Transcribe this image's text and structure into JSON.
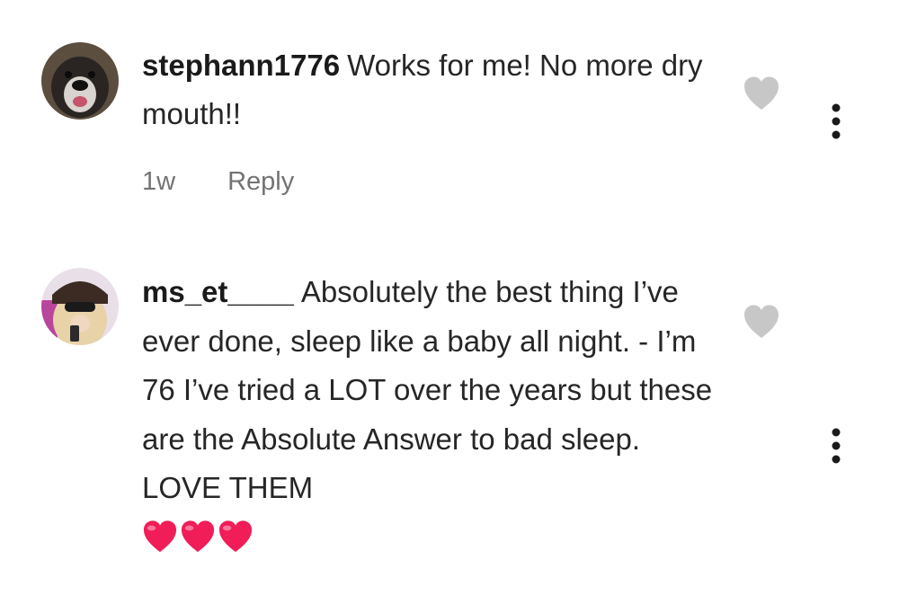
{
  "colors": {
    "text": "#262626",
    "muted": "#737373",
    "heart_icon": "#c7c7c7",
    "emoji_heart": "#f01d58"
  },
  "comments": [
    {
      "username": "stephann1776",
      "text": "Works for me! No more dry mouth!!",
      "time": "1w",
      "reply_label": "Reply",
      "avatar_icon": "dog-avatar",
      "like_icon": "heart-outline-icon",
      "more_icon": "vertical-ellipsis-icon"
    },
    {
      "username": "ms_et____",
      "text": "Absolutely the best thing I’ve ever done, sleep like a baby all night. - I’m 76 I’ve tried a LOT over the years but these are the Absolute Answer to bad sleep. LOVE THEM",
      "emojis": [
        "heart-emoji",
        "heart-emoji",
        "heart-emoji"
      ],
      "avatar_icon": "person-avatar",
      "like_icon": "heart-outline-icon",
      "more_icon": "vertical-ellipsis-icon"
    }
  ]
}
